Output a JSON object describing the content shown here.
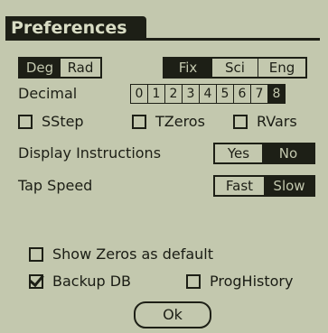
{
  "window": {
    "title": "Preferences"
  },
  "angle": {
    "options": [
      "Deg",
      "Rad"
    ],
    "selected": 0
  },
  "format": {
    "options": [
      "Fix",
      "Sci",
      "Eng"
    ],
    "selected": 0
  },
  "decimal": {
    "label": "Decimal",
    "digits": [
      "0",
      "1",
      "2",
      "3",
      "4",
      "5",
      "6",
      "7",
      "8"
    ],
    "selected": 8
  },
  "checks_row": [
    {
      "label": "SStep",
      "checked": false
    },
    {
      "label": "TZeros",
      "checked": false
    },
    {
      "label": "RVars",
      "checked": false
    }
  ],
  "display_instructions": {
    "label": "Display Instructions",
    "options": [
      "Yes",
      "No"
    ],
    "selected": 1
  },
  "tap_speed": {
    "label": "Tap Speed",
    "options": [
      "Fast",
      "Slow"
    ],
    "selected": 1
  },
  "show_zeros": {
    "label": "Show Zeros as default",
    "checked": false
  },
  "backup_db": {
    "label": "Backup DB",
    "checked": true
  },
  "prog_history": {
    "label": "ProgHistory",
    "checked": false
  },
  "ok_button": {
    "label": "Ok"
  },
  "colors": {
    "lcd_bg": "#c3c8ae",
    "ink": "#1d1f16"
  }
}
